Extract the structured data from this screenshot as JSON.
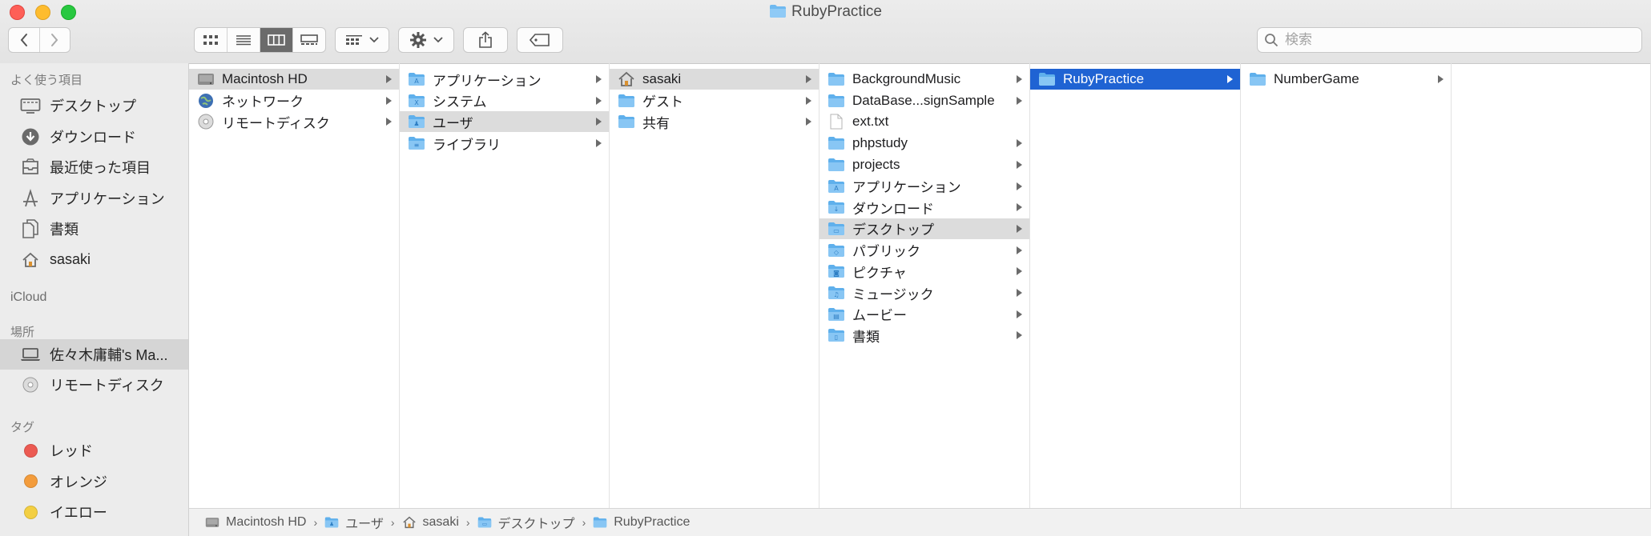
{
  "window": {
    "title": "RubyPractice"
  },
  "search": {
    "placeholder": "検索"
  },
  "sidebar": {
    "favorites_header": "よく使う項目",
    "favorites": [
      {
        "label": "デスクトップ",
        "icon": "desktop-icon"
      },
      {
        "label": "ダウンロード",
        "icon": "download-icon"
      },
      {
        "label": "最近使った項目",
        "icon": "recents-icon"
      },
      {
        "label": "アプリケーション",
        "icon": "applications-icon"
      },
      {
        "label": "書類",
        "icon": "documents-icon"
      },
      {
        "label": "sasaki",
        "icon": "home-icon"
      }
    ],
    "icloud_header": "iCloud",
    "locations_header": "場所",
    "locations": [
      {
        "label": "佐々木庸輔's Ma...",
        "icon": "laptop-icon",
        "selected": true
      },
      {
        "label": "リモートディスク",
        "icon": "disc-icon"
      }
    ],
    "tags_header": "タグ",
    "tags": [
      {
        "label": "レッド",
        "color": "#ec5a52"
      },
      {
        "label": "オレンジ",
        "color": "#f39c3c"
      },
      {
        "label": "イエロー",
        "color": "#f3cf42"
      }
    ]
  },
  "columns": [
    [
      {
        "label": "Macintosh HD",
        "icon": "disk-icon",
        "state": "path"
      },
      {
        "label": "ネットワーク",
        "icon": "network-icon"
      },
      {
        "label": "リモートディスク",
        "icon": "disc-icon"
      }
    ],
    [
      {
        "label": "アプリケーション",
        "icon": "applications-folder-icon"
      },
      {
        "label": "システム",
        "icon": "system-folder-icon"
      },
      {
        "label": "ユーザ",
        "icon": "users-folder-icon",
        "state": "path"
      },
      {
        "label": "ライブラリ",
        "icon": "library-folder-icon"
      }
    ],
    [
      {
        "label": "sasaki",
        "icon": "home-icon",
        "state": "path"
      },
      {
        "label": "ゲスト",
        "icon": "folder-icon"
      },
      {
        "label": "共有",
        "icon": "folder-icon"
      }
    ],
    [
      {
        "label": "BackgroundMusic",
        "icon": "folder-icon"
      },
      {
        "label": "DataBase...signSample",
        "icon": "folder-icon"
      },
      {
        "label": "ext.txt",
        "icon": "file-icon",
        "no_arrow": true
      },
      {
        "label": "phpstudy",
        "icon": "folder-icon"
      },
      {
        "label": "projects",
        "icon": "folder-icon"
      },
      {
        "label": "アプリケーション",
        "icon": "applications-folder-icon"
      },
      {
        "label": "ダウンロード",
        "icon": "downloads-folder-icon"
      },
      {
        "label": "デスクトップ",
        "icon": "desktop-folder-icon",
        "state": "path"
      },
      {
        "label": "パブリック",
        "icon": "public-folder-icon"
      },
      {
        "label": "ピクチャ",
        "icon": "pictures-folder-icon"
      },
      {
        "label": "ミュージック",
        "icon": "music-folder-icon"
      },
      {
        "label": "ムービー",
        "icon": "movies-folder-icon"
      },
      {
        "label": "書類",
        "icon": "documents-folder-icon"
      }
    ],
    [
      {
        "label": "RubyPractice",
        "icon": "folder-icon",
        "state": "active"
      }
    ],
    [
      {
        "label": "NumberGame",
        "icon": "folder-icon"
      }
    ],
    []
  ],
  "pathbar": [
    {
      "label": "Macintosh HD",
      "icon": "disk-icon"
    },
    {
      "label": "ユーザ",
      "icon": "users-folder-icon"
    },
    {
      "label": "sasaki",
      "icon": "home-icon"
    },
    {
      "label": "デスクトップ",
      "icon": "desktop-folder-icon"
    },
    {
      "label": "RubyPractice",
      "icon": "folder-icon"
    }
  ],
  "colors": {
    "selection": "#1f63d3",
    "path_highlight": "#dcdcdc",
    "folder": "#6fb9f0"
  }
}
